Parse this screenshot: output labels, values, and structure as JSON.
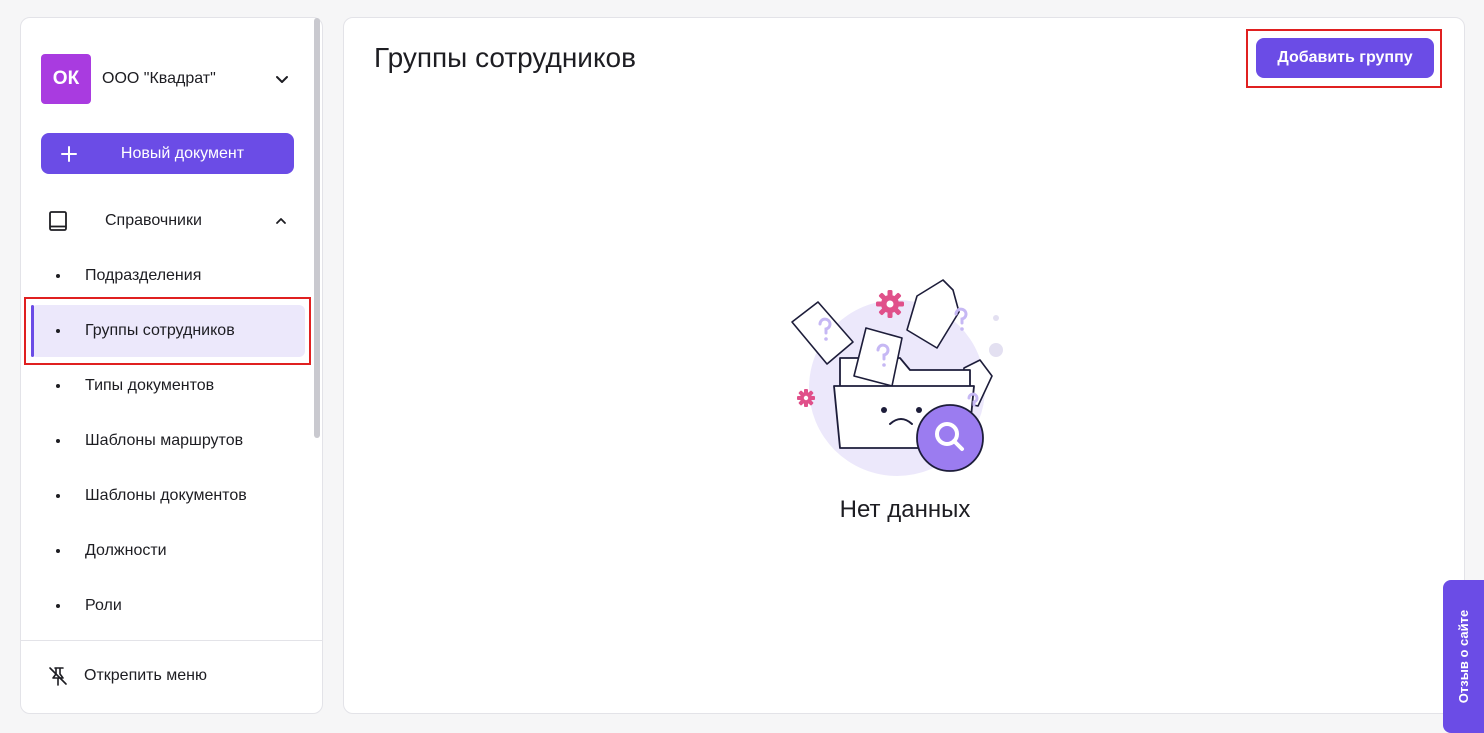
{
  "org": {
    "initials": "ОК",
    "name": "ООО \"Квадрат\""
  },
  "new_document": {
    "label": "Новый документ"
  },
  "sidebar": {
    "section_label": "Справочники",
    "items": [
      {
        "label": "Подразделения"
      },
      {
        "label": "Группы сотрудников"
      },
      {
        "label": "Типы документов"
      },
      {
        "label": "Шаблоны маршрутов"
      },
      {
        "label": "Шаблоны документов"
      },
      {
        "label": "Должности"
      },
      {
        "label": "Роли"
      }
    ],
    "unpin_label": "Открепить меню"
  },
  "main": {
    "title": "Группы сотрудников",
    "add_button": "Добавить группу",
    "empty_text": "Нет данных"
  },
  "feedback": {
    "label": "Отзыв о сайте"
  },
  "colors": {
    "accent": "#6b4ce6",
    "avatar": "#a93be0",
    "highlight": "#e02020",
    "active_bg": "#ece8fb"
  },
  "icons": [
    "chevron-down-icon",
    "plus-icon",
    "book-icon",
    "chevron-up-icon",
    "pin-off-icon",
    "search-icon",
    "gear-icon",
    "folder-icon"
  ]
}
